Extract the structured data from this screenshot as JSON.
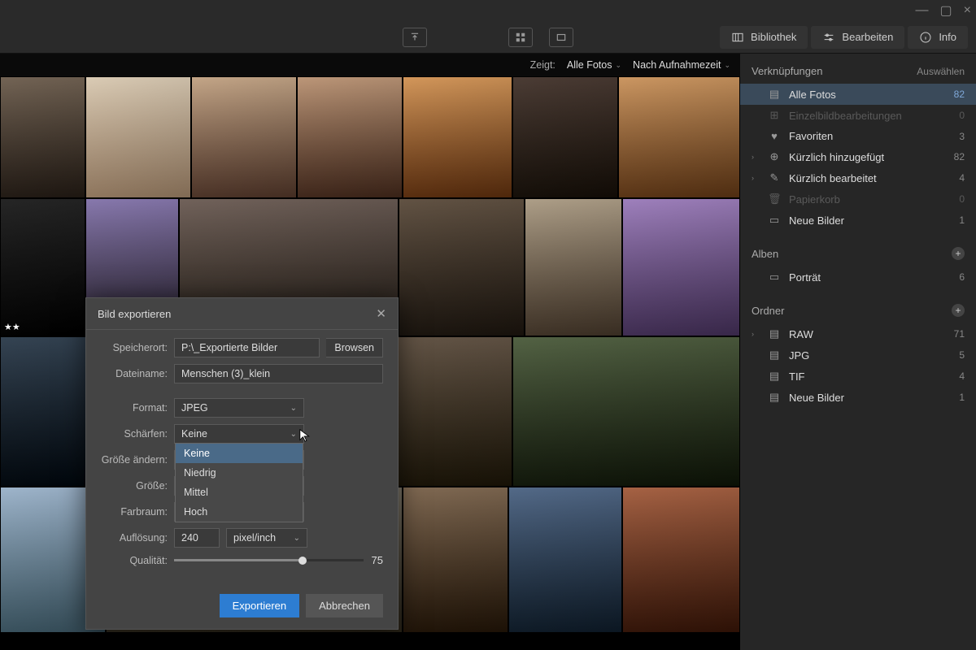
{
  "window": {
    "min": "—",
    "max": "▢",
    "close": "×"
  },
  "toolbar": {
    "tabs": {
      "library": "Bibliothek",
      "edit": "Bearbeiten",
      "info": "Info"
    }
  },
  "filterbar": {
    "shows_label": "Zeigt:",
    "shows_value": "Alle Fotos",
    "sort_value": "Nach Aufnahmezeit"
  },
  "sidebar": {
    "sec1": {
      "title": "Verknüpfungen",
      "action": "Auswählen"
    },
    "items1": [
      {
        "icon": "▤",
        "label": "Alle Fotos",
        "count": "82",
        "active": true
      },
      {
        "icon": "⊞",
        "label": "Einzelbildbearbeitungen",
        "count": "0",
        "dim": true
      },
      {
        "icon": "♥",
        "label": "Favoriten",
        "count": "3"
      },
      {
        "icon": "⊕",
        "label": "Kürzlich hinzugefügt",
        "count": "82",
        "exp": "›"
      },
      {
        "icon": "✎",
        "label": "Kürzlich bearbeitet",
        "count": "4",
        "exp": "›"
      },
      {
        "icon": "🗑",
        "label": "Papierkorb",
        "count": "0",
        "dim": true
      },
      {
        "icon": "▭",
        "label": "Neue Bilder",
        "count": "1"
      }
    ],
    "sec2": {
      "title": "Alben"
    },
    "items2": [
      {
        "icon": "▭",
        "label": "Porträt",
        "count": "6"
      }
    ],
    "sec3": {
      "title": "Ordner"
    },
    "items3": [
      {
        "icon": "▤",
        "label": "RAW",
        "count": "71",
        "exp": "›"
      },
      {
        "icon": "▤",
        "label": "JPG",
        "count": "5"
      },
      {
        "icon": "▤",
        "label": "TIF",
        "count": "4"
      },
      {
        "icon": "▤",
        "label": "Neue Bilder",
        "count": "1"
      }
    ]
  },
  "dialog": {
    "title": "Bild exportieren",
    "labels": {
      "location": "Speicherort:",
      "filename": "Dateiname:",
      "format": "Format:",
      "sharpen": "Schärfen:",
      "resize": "Größe ändern:",
      "size": "Größe:",
      "colorspace": "Farbraum:",
      "resolution": "Auflösung:",
      "quality": "Qualität:"
    },
    "values": {
      "location": "P:\\_Exportierte Bilder",
      "browse": "Browsen",
      "filename": "Menschen (3)_klein",
      "format": "JPEG",
      "sharpen": "Keine",
      "resolution": "240",
      "resolution_unit": "pixel/inch",
      "quality": "75"
    },
    "sharpen_options": [
      "Keine",
      "Niedrig",
      "Mittel",
      "Hoch"
    ],
    "buttons": {
      "export": "Exportieren",
      "cancel": "Abbrechen"
    }
  }
}
